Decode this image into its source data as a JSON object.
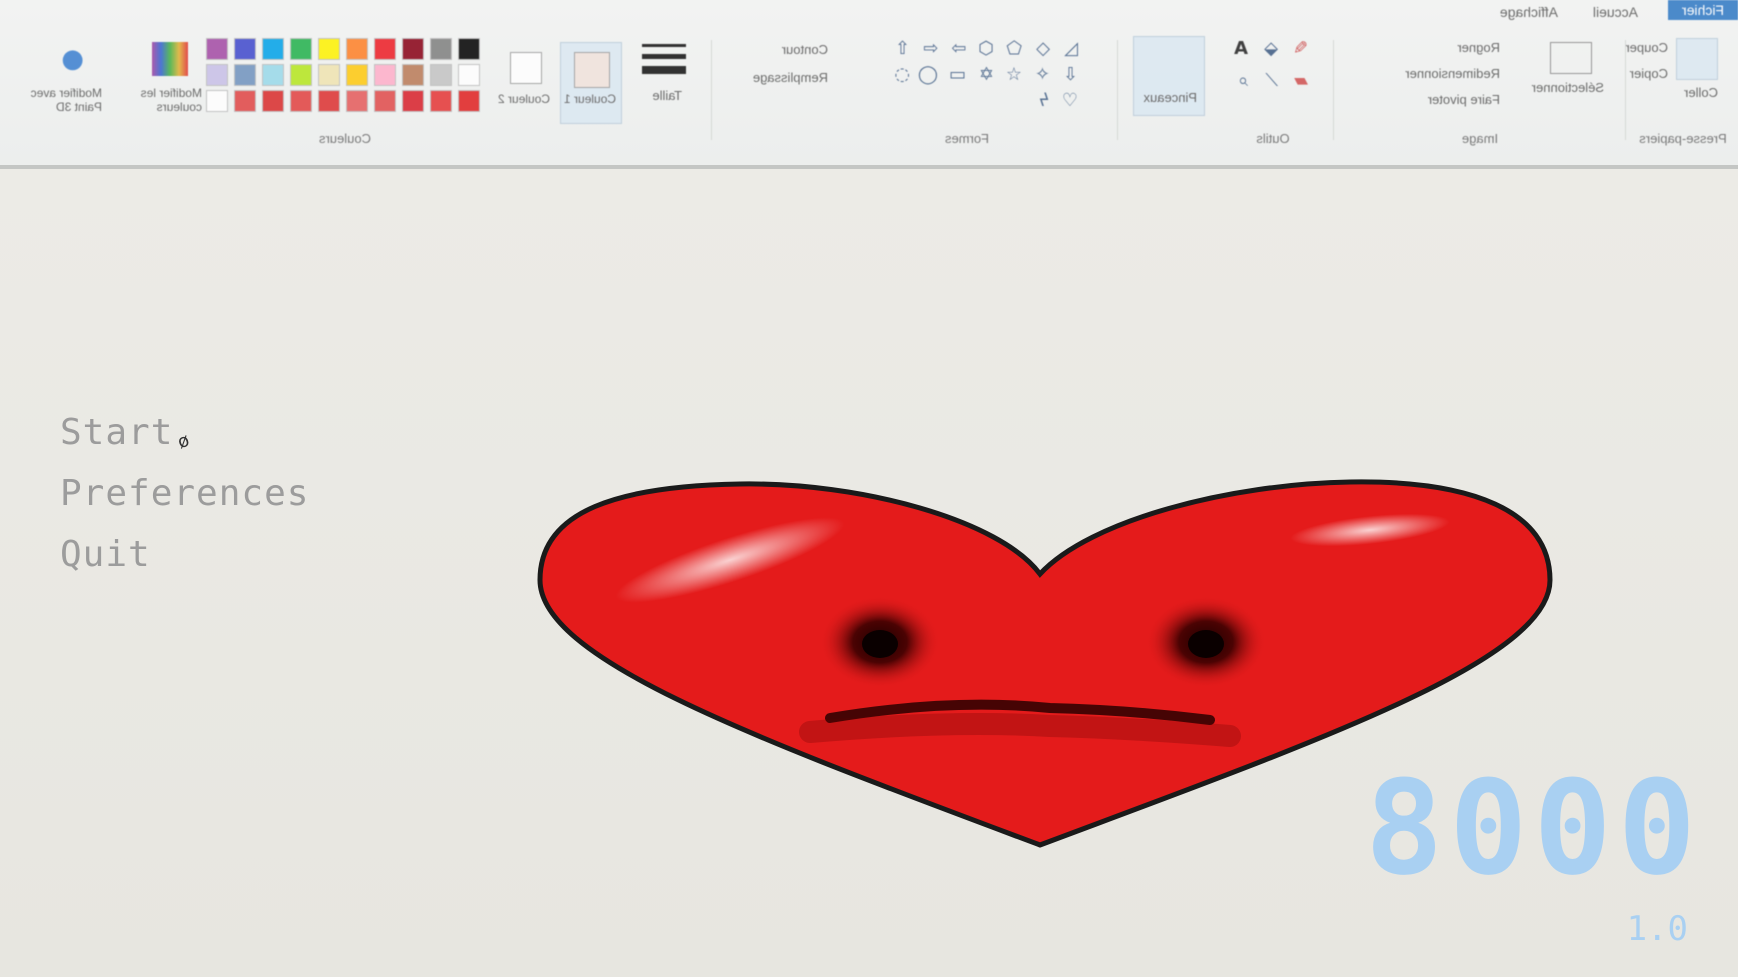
{
  "ribbon": {
    "tabs": [
      "Fichier",
      "Accueil",
      "Affichage"
    ],
    "groups": {
      "clipboard": {
        "label": "Presse-papiers",
        "paste": "Coller",
        "cut": "Couper",
        "copy": "Copier"
      },
      "image": {
        "label": "Image",
        "select": "Sélectionner",
        "crop": "Rogner",
        "resize": "Redimensionner",
        "rotate": "Faire pivoter"
      },
      "tools": {
        "label": "Outils"
      },
      "brushes": {
        "label": "Pinceaux"
      },
      "shapes": {
        "label": "Formes",
        "outline": "Contour",
        "fill": "Remplissage"
      },
      "size": {
        "label": "Taille"
      },
      "color1": {
        "label": "Couleur 1"
      },
      "color2": {
        "label": "Couleur 2"
      },
      "colors": {
        "label": "Couleurs",
        "edit": "Modifier les couleurs"
      },
      "paint3d": {
        "label": "Modifier avec Paint 3D"
      }
    },
    "palette": [
      "#000000",
      "#7f7f7f",
      "#880015",
      "#ed1c24",
      "#ff7f27",
      "#fff200",
      "#22b14c",
      "#00a2e8",
      "#3f48cc",
      "#a349a4",
      "#ffffff",
      "#c3c3c3",
      "#b97a57",
      "#ffaec9",
      "#ffc90e",
      "#efe4b0",
      "#b5e61d",
      "#99d9ea",
      "#7092be",
      "#c8bfe7",
      "#e02020",
      "#e53535",
      "#d8202a",
      "#e04a4a",
      "#e55a5a",
      "#dd3030",
      "#e24040",
      "#d92b2b",
      "#e04444",
      "#ffffff"
    ]
  },
  "menu": {
    "start": "Start",
    "preferences": "Preferences",
    "quit": "Quit"
  },
  "hud": {
    "score": "8000",
    "version": "1.0",
    "color": "#a9d0f2"
  },
  "heart": {
    "fill": "#e41b1b",
    "outline": "#1a1a1a"
  }
}
